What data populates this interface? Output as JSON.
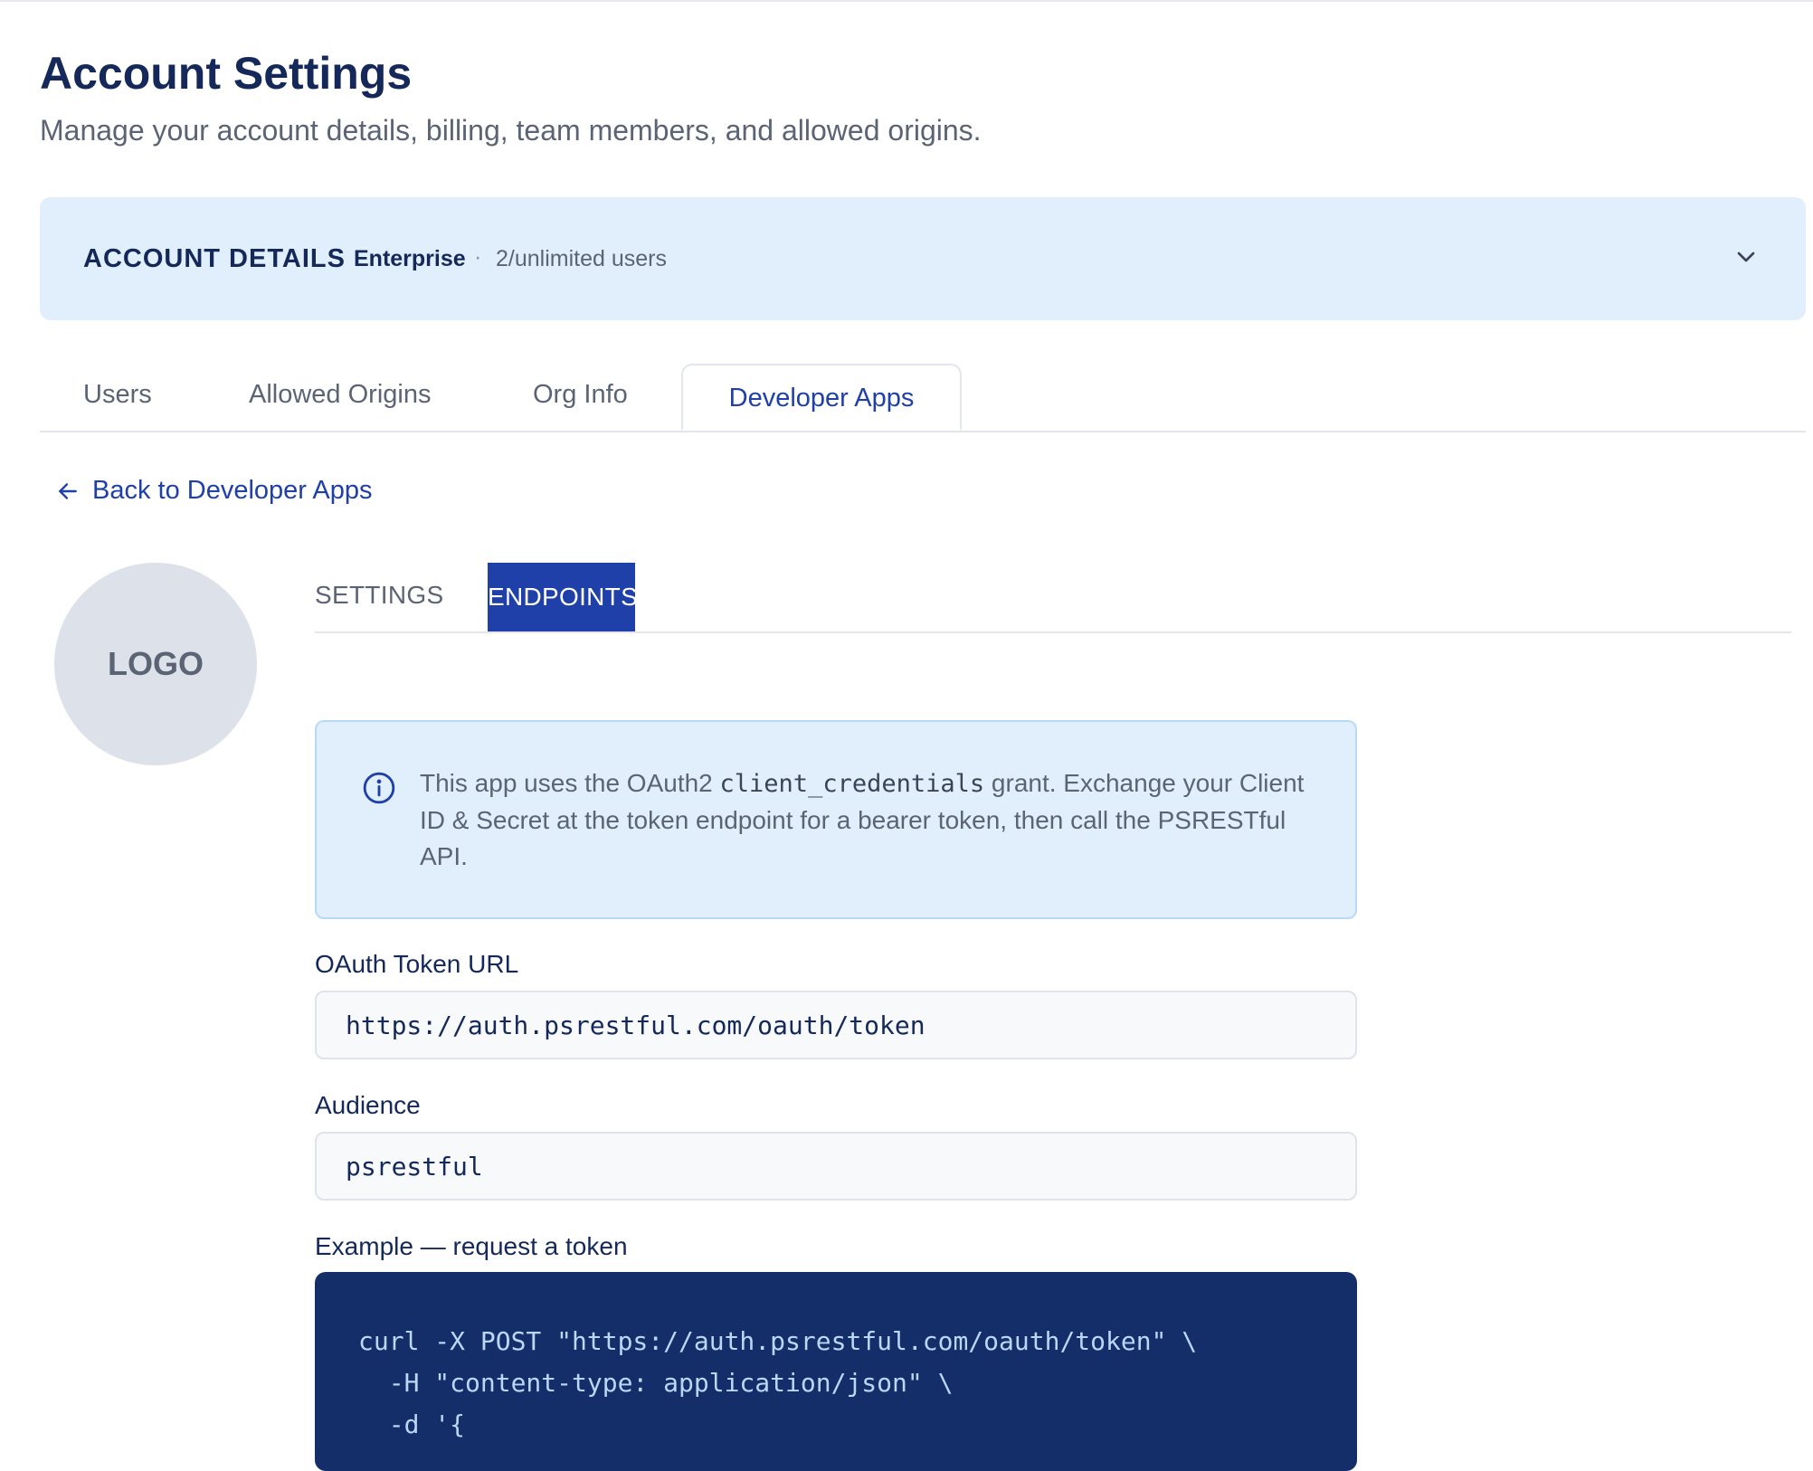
{
  "header": {
    "title": "Account Settings",
    "subtitle": "Manage your account details, billing, team members, and allowed origins."
  },
  "account_details": {
    "title": "ACCOUNT DETAILS",
    "plan": "Enterprise",
    "separator": "·",
    "users": "2/unlimited users",
    "icon": "chevron-down-icon"
  },
  "tabs": [
    {
      "label": "Users",
      "active": false
    },
    {
      "label": "Allowed Origins",
      "active": false
    },
    {
      "label": "Org Info",
      "active": false
    },
    {
      "label": "Developer Apps",
      "active": true
    }
  ],
  "back_link": {
    "label": "Back to Developer Apps",
    "icon": "arrow-left-icon"
  },
  "app": {
    "logo_text": "LOGO",
    "subtabs": [
      {
        "label": "SETTINGS",
        "active": false
      },
      {
        "label": "ENDPOINTS",
        "active": true
      }
    ]
  },
  "info_box": {
    "icon": "info-icon",
    "text_before": "This app uses the OAuth2 ",
    "code": "client_credentials",
    "text_after": " grant. Exchange your Client ID & Secret at the token endpoint for a bearer token, then call the PSRESTful API."
  },
  "fields": {
    "token_url": {
      "label": "OAuth Token URL",
      "value": "https://auth.psrestful.com/oauth/token"
    },
    "audience": {
      "label": "Audience",
      "value": "psrestful"
    }
  },
  "example": {
    "label": "Example — request a token",
    "code_lines": [
      "curl -X POST \"https://auth.psrestful.com/oauth/token\" \\",
      "  -H \"content-type: application/json\" \\",
      "  -d '{"
    ]
  },
  "colors": {
    "accent": "#1e40a8",
    "navy": "#14285a",
    "info_bg": "#e1effc",
    "code_bg": "#132e68"
  }
}
